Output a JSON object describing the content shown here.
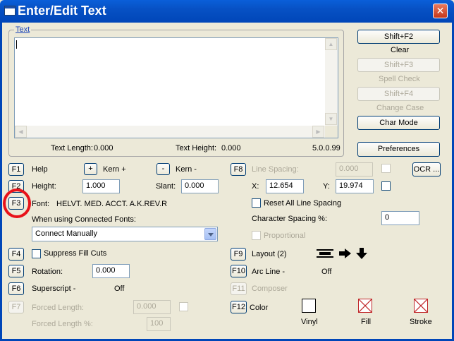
{
  "window": {
    "title": "Enter/Edit Text",
    "close_symbol": "✕"
  },
  "text_group": {
    "label": "Text",
    "text_value": "",
    "text_length_label": "Text Length:",
    "text_length_value": "0.000",
    "text_height_label": "Text Height:",
    "text_height_value": "0.000",
    "version": "5.0.0.99"
  },
  "right_panel": {
    "clear_key": "Shift+F2",
    "clear_label": "Clear",
    "spell_key": "Shift+F3",
    "spell_label": "Spell Check",
    "case_key": "Shift+F4",
    "case_label": "Change Case",
    "char_mode": "Char Mode",
    "preferences": "Preferences",
    "ocr": "OCR ..."
  },
  "fkeys": {
    "f1": "F1",
    "f2": "F2",
    "f3": "F3",
    "f4": "F4",
    "f5": "F5",
    "f6": "F6",
    "f7": "F7",
    "f8": "F8",
    "f9": "F9",
    "f10": "F10",
    "f11": "F11",
    "f12": "F12"
  },
  "help": {
    "label": "Help",
    "kern_plus_btn": "+",
    "kern_plus_label": "Kern +",
    "kern_minus_btn": "-",
    "kern_minus_label": "Kern -"
  },
  "height": {
    "label": "Height:",
    "value": "1.000"
  },
  "slant": {
    "label": "Slant:",
    "value": "0.000"
  },
  "font": {
    "label": "Font:",
    "value": "HELVT. MED. ACCT. A.K.REV.R"
  },
  "connected_fonts": {
    "label": "When using Connected Fonts:",
    "selected": "Connect Manually"
  },
  "suppress_fill_cuts": {
    "label": "Suppress Fill Cuts",
    "checked": false
  },
  "rotation": {
    "label": "Rotation:",
    "value": "0.000"
  },
  "superscript": {
    "label": "Superscript -",
    "state": "Off"
  },
  "forced_length": {
    "label": "Forced Length:",
    "value": "0.000",
    "pct_label": "Forced Length %:",
    "pct_value": "100"
  },
  "line_spacing": {
    "label": "Line Spacing:",
    "value": "0.000"
  },
  "x": {
    "label": "X:",
    "value": "12.654"
  },
  "y": {
    "label": "Y:",
    "value": "19.974"
  },
  "reset_line_spacing": {
    "label": "Reset All Line Spacing",
    "checked": false
  },
  "char_spacing": {
    "label": "Character Spacing %:",
    "value": "0"
  },
  "proportional": {
    "label": "Proportional",
    "checked": false
  },
  "layout": {
    "label": "Layout (2)"
  },
  "arc_line": {
    "label": "Arc Line -",
    "state": "Off"
  },
  "composer": {
    "label": "Composer"
  },
  "color": {
    "label": "Color",
    "vinyl": "Vinyl",
    "fill": "Fill",
    "stroke": "Stroke"
  },
  "colors": {
    "title_bar": "#0751c4",
    "annotation_circle": "#e8121a",
    "fill_x": "#c0282a"
  }
}
